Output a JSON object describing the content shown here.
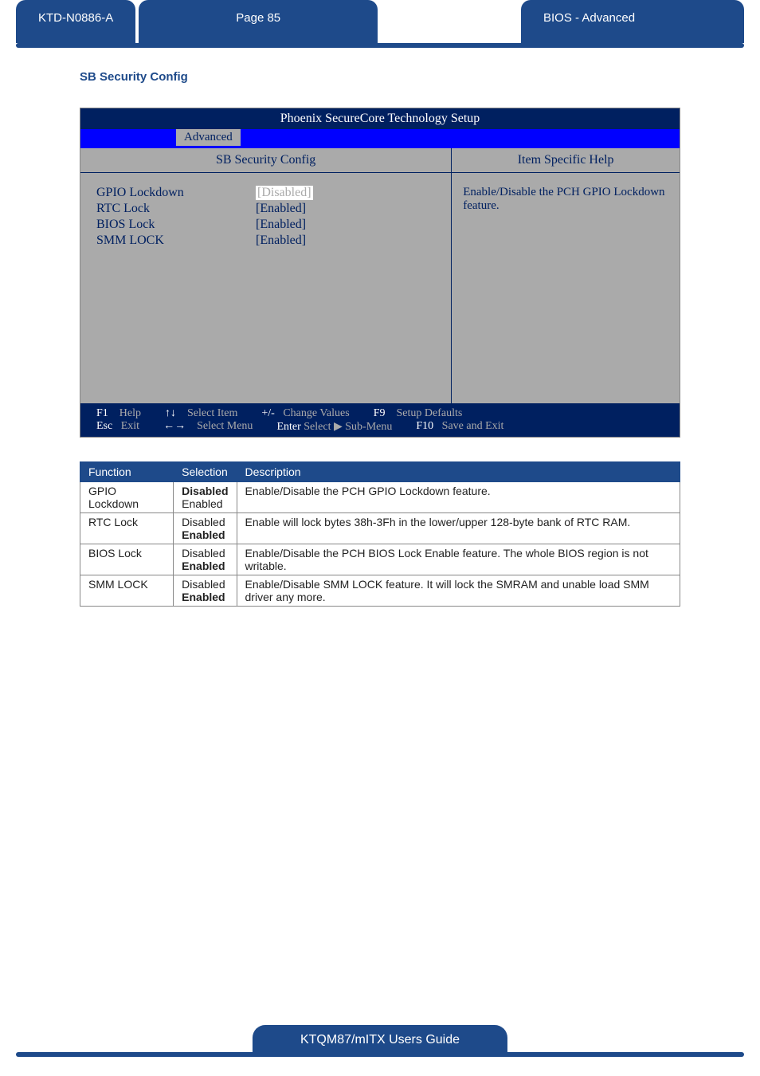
{
  "header": {
    "doc_id": "KTD-N0886-A",
    "page_label": "Page 85",
    "section_path": "BIOS  - Advanced"
  },
  "section_title": "SB Security Config",
  "bios": {
    "title": "Phoenix SecureCore Technology Setup",
    "active_tab": "Advanced",
    "panel_title_left": "SB Security Config",
    "panel_title_right": "Item Specific Help",
    "help_text": "Enable/Disable the PCH GPIO Lockdown feature.",
    "items": [
      {
        "label": "GPIO Lockdown",
        "value": "[Disabled]",
        "selected": true
      },
      {
        "label": "RTC Lock",
        "value": "[Enabled]",
        "selected": false
      },
      {
        "label": "BIOS Lock",
        "value": "[Enabled]",
        "selected": false
      },
      {
        "label": "SMM LOCK",
        "value": "[Enabled]",
        "selected": false
      }
    ],
    "footer": {
      "row1": [
        {
          "key": "F1",
          "label": "Help"
        },
        {
          "key": "↑↓",
          "label": "Select Item"
        },
        {
          "key": "+/-",
          "label": "Change Values"
        },
        {
          "key": "F9",
          "label": "Setup Defaults"
        }
      ],
      "row2": [
        {
          "key": "Esc",
          "label": "Exit"
        },
        {
          "key": "←→",
          "label": "Select Menu"
        },
        {
          "key": "Enter",
          "label": "Select ▶ Sub-Menu"
        },
        {
          "key": "F10",
          "label": "Save and Exit"
        }
      ]
    }
  },
  "table": {
    "headers": [
      "Function",
      "Selection",
      "Description"
    ],
    "rows": [
      {
        "func": "GPIO Lockdown",
        "sel": [
          {
            "t": "Disabled",
            "b": true
          },
          {
            "t": "Enabled",
            "b": false
          }
        ],
        "desc": "Enable/Disable the PCH GPIO Lockdown feature."
      },
      {
        "func": "RTC Lock",
        "sel": [
          {
            "t": "Disabled",
            "b": false
          },
          {
            "t": "Enabled",
            "b": true
          }
        ],
        "desc": "Enable will lock bytes 38h-3Fh in the lower/upper 128-byte bank of RTC RAM."
      },
      {
        "func": "BIOS Lock",
        "sel": [
          {
            "t": "Disabled",
            "b": false
          },
          {
            "t": "Enabled",
            "b": true
          }
        ],
        "desc": "Enable/Disable the PCH BIOS Lock Enable feature. The whole BIOS region is not writable."
      },
      {
        "func": "SMM LOCK",
        "sel": [
          {
            "t": "Disabled",
            "b": false
          },
          {
            "t": "Enabled",
            "b": true
          }
        ],
        "desc": "Enable/Disable SMM LOCK feature. It will lock the SMRAM and unable load SMM driver any more."
      }
    ]
  },
  "footer_text": "KTQM87/mITX Users Guide"
}
